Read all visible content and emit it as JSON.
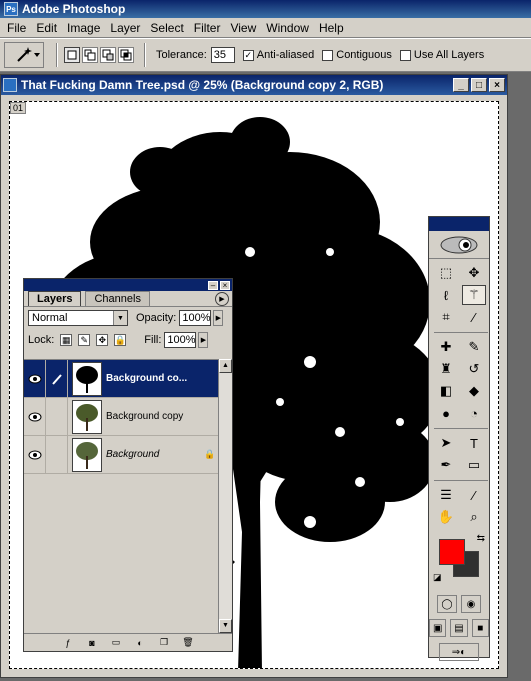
{
  "app": {
    "title": "Adobe Photoshop"
  },
  "menu": [
    "File",
    "Edit",
    "Image",
    "Layer",
    "Select",
    "Filter",
    "View",
    "Window",
    "Help"
  ],
  "options": {
    "tolerance_label": "Tolerance:",
    "tolerance_value": "35",
    "anti_aliased_label": "Anti-aliased",
    "anti_aliased_checked": true,
    "contiguous_label": "Contiguous",
    "contiguous_checked": false,
    "use_all_layers_label": "Use All Layers",
    "use_all_layers_checked": false
  },
  "document": {
    "title": "That Fucking Damn Tree.psd @ 25% (Background copy 2, RGB)",
    "zoom_badge": "01"
  },
  "layers_palette": {
    "tabs": [
      "Layers",
      "Channels"
    ],
    "active_tab": "Layers",
    "blend_mode": "Normal",
    "opacity_label": "Opacity:",
    "opacity_value": "100%",
    "lock_label": "Lock:",
    "fill_label": "Fill:",
    "fill_value": "100%",
    "layers": [
      {
        "name": "Background co...",
        "selected": true,
        "visible": true,
        "italic": false,
        "locked": false
      },
      {
        "name": "Background copy",
        "selected": false,
        "visible": true,
        "italic": false,
        "locked": false
      },
      {
        "name": "Background",
        "selected": false,
        "visible": true,
        "italic": true,
        "locked": true
      }
    ]
  },
  "toolbox": {
    "foreground_color": "#ff0000",
    "background_color": "#303030"
  },
  "colors": {
    "titlebar": "#0a246a",
    "chrome": "#d4d0c8"
  }
}
